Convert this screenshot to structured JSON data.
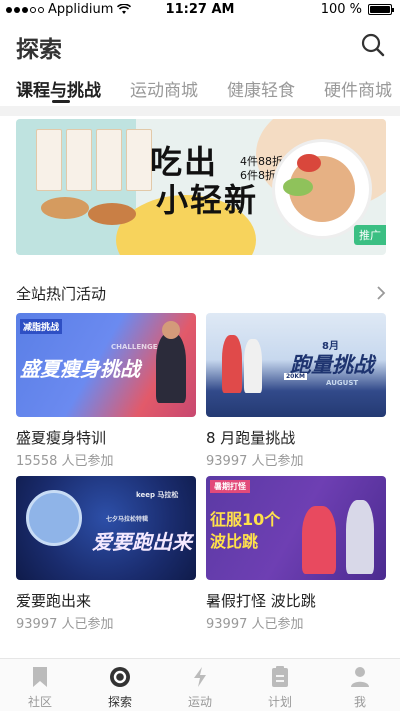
{
  "status_bar": {
    "carrier": "Applidium",
    "time": "11:27 AM",
    "battery": "100 %",
    "battery_level": 1.0
  },
  "header": {
    "title": "探索",
    "search_icon": "search-icon"
  },
  "tabs": [
    {
      "label": "课程与挑战",
      "active": true
    },
    {
      "label": "运动商城",
      "active": false
    },
    {
      "label": "健康轻食",
      "active": false
    },
    {
      "label": "硬件商城",
      "active": false
    }
  ],
  "banner": {
    "headline_line1": "吃出",
    "headline_line2": "小轻新",
    "sub_line1": "4件88折",
    "sub_line2": "6件8折",
    "ad_label": "推广"
  },
  "section": {
    "title": "全站热门活动",
    "arrow_icon": "chevron-right-icon"
  },
  "cards": [
    {
      "title": "盛夏瘦身特训",
      "participants": "15558 人已参加",
      "image_badge": "减脂挑战",
      "image_text": "盛夏瘦身挑战",
      "image_small": "CHALLENGE"
    },
    {
      "title": "8 月跑量挑战",
      "participants": "93997 人已参加",
      "image_text": "跑量挑战",
      "image_small": "8月",
      "image_small2": "AUGUST",
      "image_sign": "20KM"
    },
    {
      "title": "爱要跑出来",
      "participants": "93997 人已参加",
      "image_badge": "keep 马拉松",
      "image_text": "爱要跑出来",
      "image_small": "七夕马拉松特辑"
    },
    {
      "title": "暑假打怪 波比跳",
      "participants": "93997 人已参加",
      "image_badge": "暑期打怪",
      "image_text_line1": "征服10个",
      "image_text_line2": "波比跳"
    }
  ],
  "tabbar": [
    {
      "label": "社区",
      "icon": "bookmark-icon",
      "active": false
    },
    {
      "label": "探索",
      "icon": "explore-icon",
      "active": true
    },
    {
      "label": "运动",
      "icon": "lightning-icon",
      "active": false
    },
    {
      "label": "计划",
      "icon": "clipboard-icon",
      "active": false
    },
    {
      "label": "我",
      "icon": "person-icon",
      "active": false
    }
  ],
  "colors": {
    "accent": "#222222",
    "muted": "#999999",
    "ad_badge": "#3bbf83",
    "divider": "#f2f2f2"
  }
}
